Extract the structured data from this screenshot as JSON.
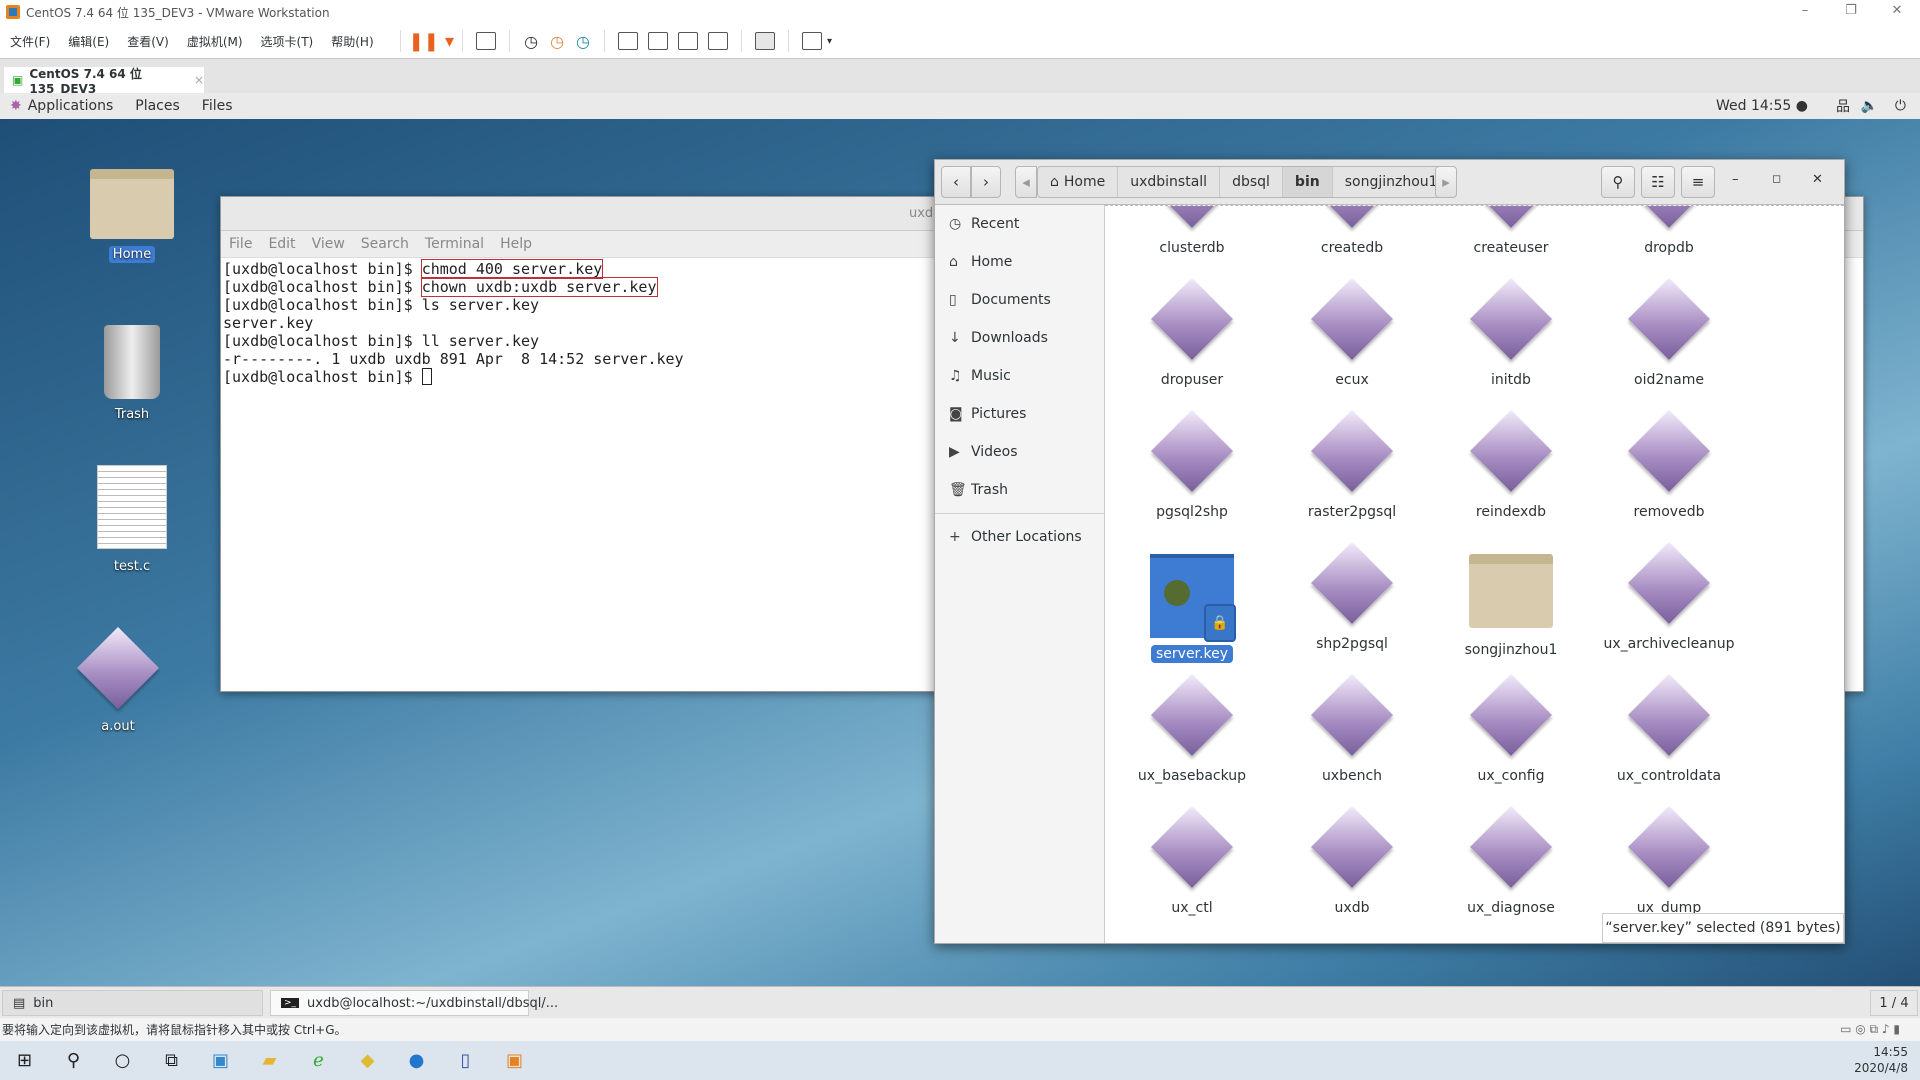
{
  "vmware": {
    "title": "CentOS 7.4 64 位 135_DEV3 - VMware Workstation",
    "menu": [
      "文件(F)",
      "编辑(E)",
      "查看(V)",
      "虚拟机(M)",
      "选项卡(T)",
      "帮助(H)"
    ],
    "tab": "CentOS 7.4 64 位 135_DEV3",
    "status": "要将输入定向到该虚拟机，请将鼠标指针移入其中或按 Ctrl+G。"
  },
  "gnome": {
    "applications": "Applications",
    "places": "Places",
    "files": "Files",
    "clock": "Wed 14:55 ●"
  },
  "desktop": {
    "icons": [
      "Home",
      "Trash",
      "test.c",
      "a.out"
    ]
  },
  "terminal": {
    "title": "uxd",
    "menu": [
      "File",
      "Edit",
      "View",
      "Search",
      "Terminal",
      "Help"
    ],
    "prompt": "[uxdb@localhost bin]$ ",
    "lines": [
      {
        "cmd": "chmod 400 server.key"
      },
      {
        "cmd": "chown uxdb:uxdb server.key"
      },
      {
        "cmd": "ls server.key"
      },
      {
        "out": "server.key"
      },
      {
        "cmd": "ll server.key"
      },
      {
        "out": "-r--------. 1 uxdb uxdb 891 Apr  8 14:52 server.key"
      }
    ]
  },
  "files": {
    "breadcrumbs": [
      "Home",
      "uxdbinstall",
      "dbsql",
      "bin",
      "songjinzhou1"
    ],
    "sidebar": [
      {
        "icon": "clock-icon",
        "label": "Recent"
      },
      {
        "icon": "home-icon",
        "label": "Home"
      },
      {
        "icon": "document-icon",
        "label": "Documents"
      },
      {
        "icon": "download-icon",
        "label": "Downloads"
      },
      {
        "icon": "music-icon",
        "label": "Music"
      },
      {
        "icon": "camera-icon",
        "label": "Pictures"
      },
      {
        "icon": "video-icon",
        "label": "Videos"
      },
      {
        "icon": "trash-icon",
        "label": "Trash"
      }
    ],
    "other_locations": "Other Locations",
    "items": [
      "clusterdb",
      "createdb",
      "createuser",
      "dropdb",
      "dropuser",
      "ecux",
      "initdb",
      "oid2name",
      "pgsql2shp",
      "raster2pgsql",
      "reindexdb",
      "removedb",
      "server.key",
      "shp2pgsql",
      "songjinzhou1",
      "ux_archivecleanup",
      "ux_basebackup",
      "uxbench",
      "ux_config",
      "ux_controldata",
      "ux_ctl",
      "uxdb",
      "ux_diagnose",
      "ux_dump"
    ],
    "selected": "server.key",
    "status": "“server.key” selected  (891 bytes)"
  },
  "taskbar": {
    "items": [
      "bin",
      "uxdb@localhost:~/uxdbinstall/dbsql/..."
    ],
    "workspace": "1 / 4"
  },
  "windows": {
    "time": "14:55",
    "date": "2020/4/8"
  }
}
